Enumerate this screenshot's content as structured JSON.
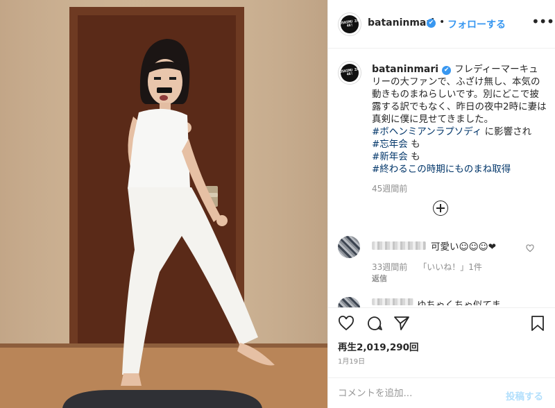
{
  "post": {
    "username": "bataninmari",
    "verified_glyph": "✔",
    "separator": "•",
    "follow_label": "フォローする",
    "more_label": "•••",
    "avatar_text": "USHIMU ZA 46!"
  },
  "caption": {
    "username": "bataninmari",
    "text": "フレディーマーキュリーの大ファンで、ふざけ無し、本気の動きものまねらしいです。別にどこで披露する訳でもなく、昨日の夜中2時に妻は真剣に僕に見せてきました。",
    "tags": [
      {
        "tag": "#ボヘンミアンラプソディ",
        "suffix": " に影響され"
      },
      {
        "tag": "#忘年会",
        "suffix": " も"
      },
      {
        "tag": "#新年会",
        "suffix": " も"
      },
      {
        "tag": "#終わるこの時期にものまね取得",
        "suffix": ""
      }
    ],
    "age": "45週間前"
  },
  "comments": [
    {
      "text": "可愛い☺☺☺❤",
      "age": "33週間前",
      "likes": "「いいね！」1件",
      "reply": "返信"
    },
    {
      "text": "ゆちゃくちゃ似てま"
    }
  ],
  "actions": {
    "views_label": "再生",
    "views_count": "2,019,290",
    "views_suffix": "回",
    "date": "1月19日"
  },
  "comment_box": {
    "placeholder": "コメントを追加...",
    "post_label": "投稿する"
  },
  "colors": {
    "accent": "#3897f0",
    "tag": "#003569",
    "muted": "#8e8e8e",
    "post_disabled": "#b2dffc"
  },
  "icons": [
    "heart-icon",
    "comment-icon",
    "share-icon",
    "bookmark-icon",
    "plus-circle-icon",
    "verified-icon"
  ]
}
